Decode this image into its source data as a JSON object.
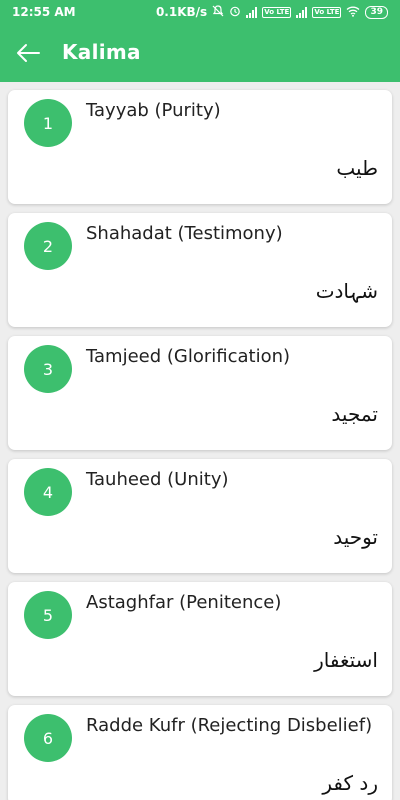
{
  "status_bar": {
    "time": "12:55 AM",
    "speed": "0.1KB/s",
    "sim1": "Vo LTE",
    "sim2": "Vo LTE",
    "battery": "39"
  },
  "toolbar": {
    "title": "Kalima",
    "back_icon": "arrow-left-icon"
  },
  "colors": {
    "primary": "#3dbf6e",
    "background": "#eeeeee",
    "card": "#ffffff"
  },
  "kalimas": [
    {
      "number": "1",
      "title": "Tayyab (Purity)",
      "urdu": "طیب"
    },
    {
      "number": "2",
      "title": "Shahadat (Testimony)",
      "urdu": "شہادت"
    },
    {
      "number": "3",
      "title": "Tamjeed (Glorification)",
      "urdu": "تمجید"
    },
    {
      "number": "4",
      "title": "Tauheed (Unity)",
      "urdu": "توحید"
    },
    {
      "number": "5",
      "title": "Astaghfar (Penitence)",
      "urdu": "استغفار"
    },
    {
      "number": "6",
      "title": "Radde Kufr (Rejecting Disbelief)",
      "urdu": "رد کفر"
    }
  ]
}
